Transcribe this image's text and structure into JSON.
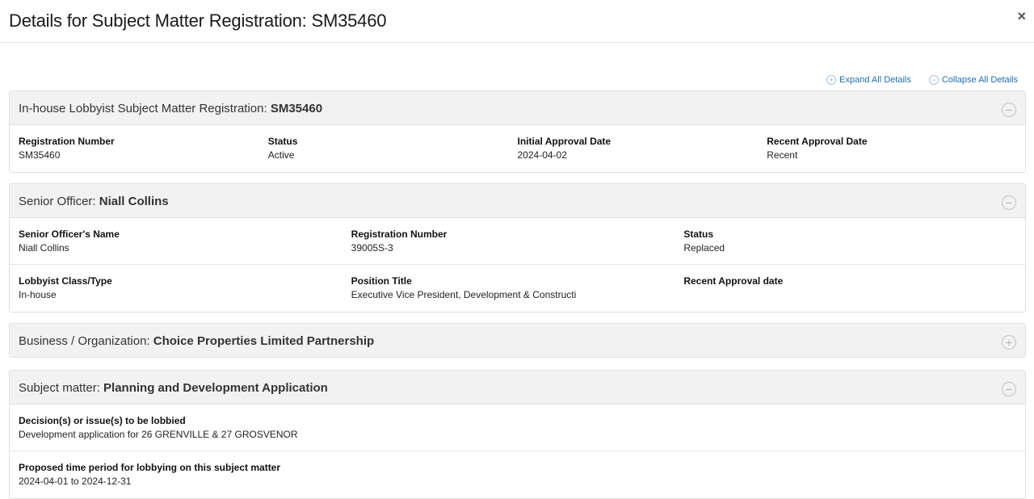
{
  "modal": {
    "title": "Details for Subject Matter Registration: SM35460",
    "close_glyph": "×"
  },
  "controls": {
    "expand_label": "Expand All Details",
    "collapse_label": "Collapse All Details"
  },
  "registration_panel": {
    "title_prefix": "In-house Lobbyist Subject Matter Registration: ",
    "title_value": "SM35460",
    "fields": [
      {
        "label": "Registration Number",
        "value": "SM35460"
      },
      {
        "label": "Status",
        "value": "Active"
      },
      {
        "label": "Initial Approval Date",
        "value": "2024-04-02"
      },
      {
        "label": "Recent Approval Date",
        "value": "Recent"
      }
    ]
  },
  "officer_panel": {
    "title_prefix": "Senior Officer: ",
    "title_value": "Niall Collins",
    "row1": [
      {
        "label": "Senior Officer's Name",
        "value": "Niall Collins"
      },
      {
        "label": "Registration Number",
        "value": "39005S-3"
      },
      {
        "label": "Status",
        "value": "Replaced"
      }
    ],
    "row2": [
      {
        "label": "Lobbyist Class/Type",
        "value": "In-house"
      },
      {
        "label": "Position Title",
        "value": "Executive Vice President, Development & Constructi"
      },
      {
        "label": "Recent Approval date",
        "value": ""
      }
    ]
  },
  "business_panel": {
    "title_prefix": "Business / Organization: ",
    "title_value": "Choice Properties Limited Partnership"
  },
  "subject_panel": {
    "title_prefix": "Subject matter: ",
    "title_value": "Planning and Development Application",
    "fields": [
      {
        "label": "Decision(s) or issue(s) to be lobbied",
        "value": "Development application for 26 GRENVILLE & 27 GROSVENOR"
      },
      {
        "label": "Proposed time period for lobbying on this subject matter",
        "value": "2024-04-01 to 2024-12-31"
      }
    ]
  },
  "icons": {
    "expand": "plus-circle-icon",
    "collapse": "minus-circle-icon"
  }
}
